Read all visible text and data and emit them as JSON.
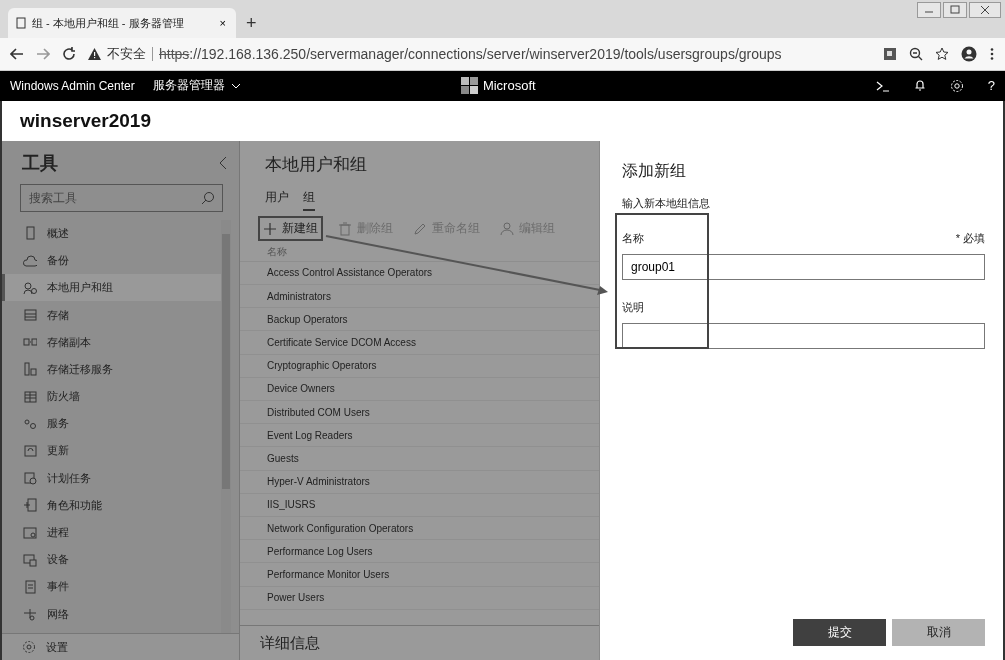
{
  "browser": {
    "tab": {
      "title": "组 - 本地用户和组 - 服务器管理",
      "close": "×"
    },
    "new_tab": "+",
    "address": {
      "warning": "不安全",
      "url_scheme": "https",
      "url_rest": "://192.168.136.250/servermanager/connections/server/winserver2019/tools/usersgroups/groups"
    }
  },
  "app_header": {
    "product": "Windows Admin Center",
    "menu": "服务器管理器",
    "brand": "Microsoft",
    "help": "?"
  },
  "server_name": "winserver2019",
  "sidebar": {
    "title": "工具",
    "search": {
      "placeholder": "搜索工具"
    },
    "items": [
      {
        "label": "概述",
        "selected": false
      },
      {
        "label": "备份",
        "selected": false
      },
      {
        "label": "本地用户和组",
        "selected": true
      },
      {
        "label": "存储",
        "selected": false
      },
      {
        "label": "存储副本",
        "selected": false
      },
      {
        "label": "存储迁移服务",
        "selected": false
      },
      {
        "label": "防火墙",
        "selected": false
      },
      {
        "label": "服务",
        "selected": false
      },
      {
        "label": "更新",
        "selected": false
      },
      {
        "label": "计划任务",
        "selected": false
      },
      {
        "label": "角色和功能",
        "selected": false
      },
      {
        "label": "进程",
        "selected": false
      },
      {
        "label": "设备",
        "selected": false
      },
      {
        "label": "事件",
        "selected": false
      },
      {
        "label": "网络",
        "selected": false
      }
    ],
    "footer": "设置"
  },
  "groups": {
    "title": "本地用户和组",
    "tabs": [
      {
        "label": "用户",
        "selected": false
      },
      {
        "label": "组",
        "selected": true
      }
    ],
    "toolbar": [
      {
        "label": "新建组",
        "kind": "plus",
        "disabled": false,
        "highlighted": true
      },
      {
        "label": "删除组",
        "kind": "trash",
        "disabled": true,
        "highlighted": false
      },
      {
        "label": "重命名组",
        "kind": "pencil",
        "disabled": true,
        "highlighted": false
      },
      {
        "label": "编辑组",
        "kind": "person",
        "disabled": true,
        "highlighted": false
      }
    ],
    "column": "名称",
    "rows": [
      "Access Control Assistance Operators",
      "Administrators",
      "Backup Operators",
      "Certificate Service DCOM Access",
      "Cryptographic Operators",
      "Device Owners",
      "Distributed COM Users",
      "Event Log Readers",
      "Guests",
      "Hyper-V Administrators",
      "IIS_IUSRS",
      "Network Configuration Operators",
      "Performance Log Users",
      "Performance Monitor Users",
      "Power Users"
    ],
    "details": "详细信息"
  },
  "panel": {
    "title": "添加新组",
    "subtitle": "输入新本地组信息",
    "required_note": "* 必填",
    "fields": [
      {
        "label": "名称",
        "value": "group01"
      },
      {
        "label": "说明"
      }
    ],
    "buttons": [
      {
        "label": "提交",
        "kind": "primary"
      },
      {
        "label": "取消",
        "kind": "secondary"
      }
    ]
  }
}
